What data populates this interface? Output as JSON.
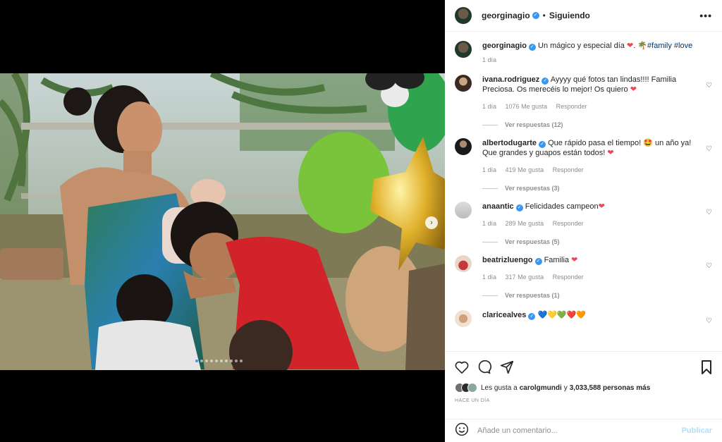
{
  "post": {
    "username": "georginagio",
    "follow_status": "Siguiendo",
    "more_icon": "more-horizontal-icon",
    "caption_text": "Un mágico y especial día",
    "caption_hashtags": "#family #love",
    "caption_time": "1 día"
  },
  "comments": [
    {
      "user": "ivana.rodriguez",
      "text": "Ayyyy qué fotos tan lindas!!!! Familia Preciosa. Os merecéis lo mejor! Os quiero",
      "time": "1 día",
      "likes": "1076 Me gusta",
      "reply": "Responder",
      "view_replies": "Ver respuestas (12)"
    },
    {
      "user": "albertodugarte",
      "text": "Que rápido pasa el tiempo! 🤩 un año ya! Que grandes y guapos están todos!",
      "time": "1 día",
      "likes": "419 Me gusta",
      "reply": "Responder",
      "view_replies": "Ver respuestas (3)"
    },
    {
      "user": "anaantic",
      "text": "Felicidades campeon",
      "time": "1 día",
      "likes": "289 Me gusta",
      "reply": "Responder",
      "view_replies": "Ver respuestas (5)"
    },
    {
      "user": "beatrizluengo",
      "text": "Familia",
      "time": "1 día",
      "likes": "317 Me gusta",
      "reply": "Responder",
      "view_replies": "Ver respuestas (1)"
    },
    {
      "user": "claricealves",
      "text": "💙💛💚❤️🧡"
    }
  ],
  "likes_summary": {
    "prefix": "Les gusta a",
    "user": "carolgmundi",
    "connector": "y",
    "count": "3,033,588 personas más"
  },
  "post_date": "HACE UN DÍA",
  "add_comment": {
    "placeholder": "Añade un comentario...",
    "publish_label": "Publicar"
  },
  "colors": {
    "accent": "#3897f0",
    "heart": "#ed4956",
    "publish_disabled": "#b2dffc"
  },
  "carousel": {
    "total_slides": 10,
    "current_slide": 1
  }
}
